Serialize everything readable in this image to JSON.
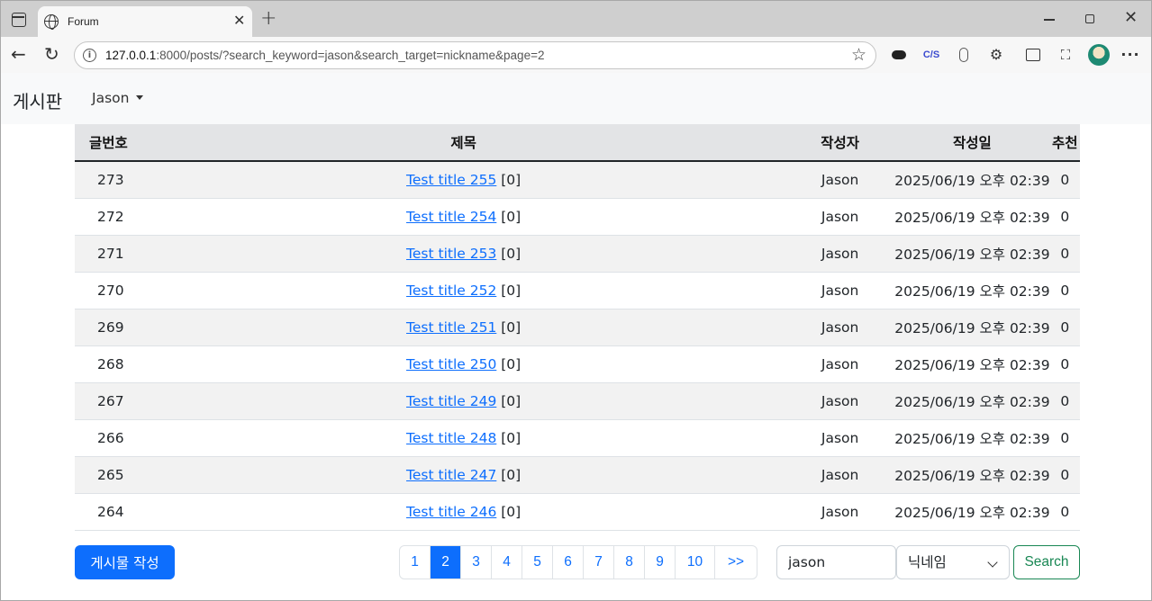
{
  "browser": {
    "tab_title": "Forum",
    "url_host": "127.0.0.1",
    "url_rest": ":8000/posts/?search_keyword=jason&search_target=nickname&page=2",
    "extension_cs_label": "C/S"
  },
  "navbar": {
    "brand": "게시판",
    "user": "Jason"
  },
  "table": {
    "headers": {
      "no": "글번호",
      "title": "제목",
      "writer": "작성자",
      "date": "작성일",
      "recommend": "추천"
    },
    "rows": [
      {
        "no": "273",
        "title": "Test title 255",
        "comments": "[0]",
        "writer": "Jason",
        "date": "2025/06/19 오후 02:39",
        "recommend": "0"
      },
      {
        "no": "272",
        "title": "Test title 254",
        "comments": "[0]",
        "writer": "Jason",
        "date": "2025/06/19 오후 02:39",
        "recommend": "0"
      },
      {
        "no": "271",
        "title": "Test title 253",
        "comments": "[0]",
        "writer": "Jason",
        "date": "2025/06/19 오후 02:39",
        "recommend": "0"
      },
      {
        "no": "270",
        "title": "Test title 252",
        "comments": "[0]",
        "writer": "Jason",
        "date": "2025/06/19 오후 02:39",
        "recommend": "0"
      },
      {
        "no": "269",
        "title": "Test title 251",
        "comments": "[0]",
        "writer": "Jason",
        "date": "2025/06/19 오후 02:39",
        "recommend": "0"
      },
      {
        "no": "268",
        "title": "Test title 250",
        "comments": "[0]",
        "writer": "Jason",
        "date": "2025/06/19 오후 02:39",
        "recommend": "0"
      },
      {
        "no": "267",
        "title": "Test title 249",
        "comments": "[0]",
        "writer": "Jason",
        "date": "2025/06/19 오후 02:39",
        "recommend": "0"
      },
      {
        "no": "266",
        "title": "Test title 248",
        "comments": "[0]",
        "writer": "Jason",
        "date": "2025/06/19 오후 02:39",
        "recommend": "0"
      },
      {
        "no": "265",
        "title": "Test title 247",
        "comments": "[0]",
        "writer": "Jason",
        "date": "2025/06/19 오후 02:39",
        "recommend": "0"
      },
      {
        "no": "264",
        "title": "Test title 246",
        "comments": "[0]",
        "writer": "Jason",
        "date": "2025/06/19 오후 02:39",
        "recommend": "0"
      }
    ]
  },
  "footer": {
    "write_button": "게시물 작성",
    "pages": [
      "1",
      "2",
      "3",
      "4",
      "5",
      "6",
      "7",
      "8",
      "9",
      "10",
      ">>"
    ],
    "current_page": "2",
    "search_value": "jason",
    "search_target": "닉네임",
    "search_button": "Search"
  },
  "colors": {
    "primary": "#0d6efd",
    "success": "#198754"
  }
}
